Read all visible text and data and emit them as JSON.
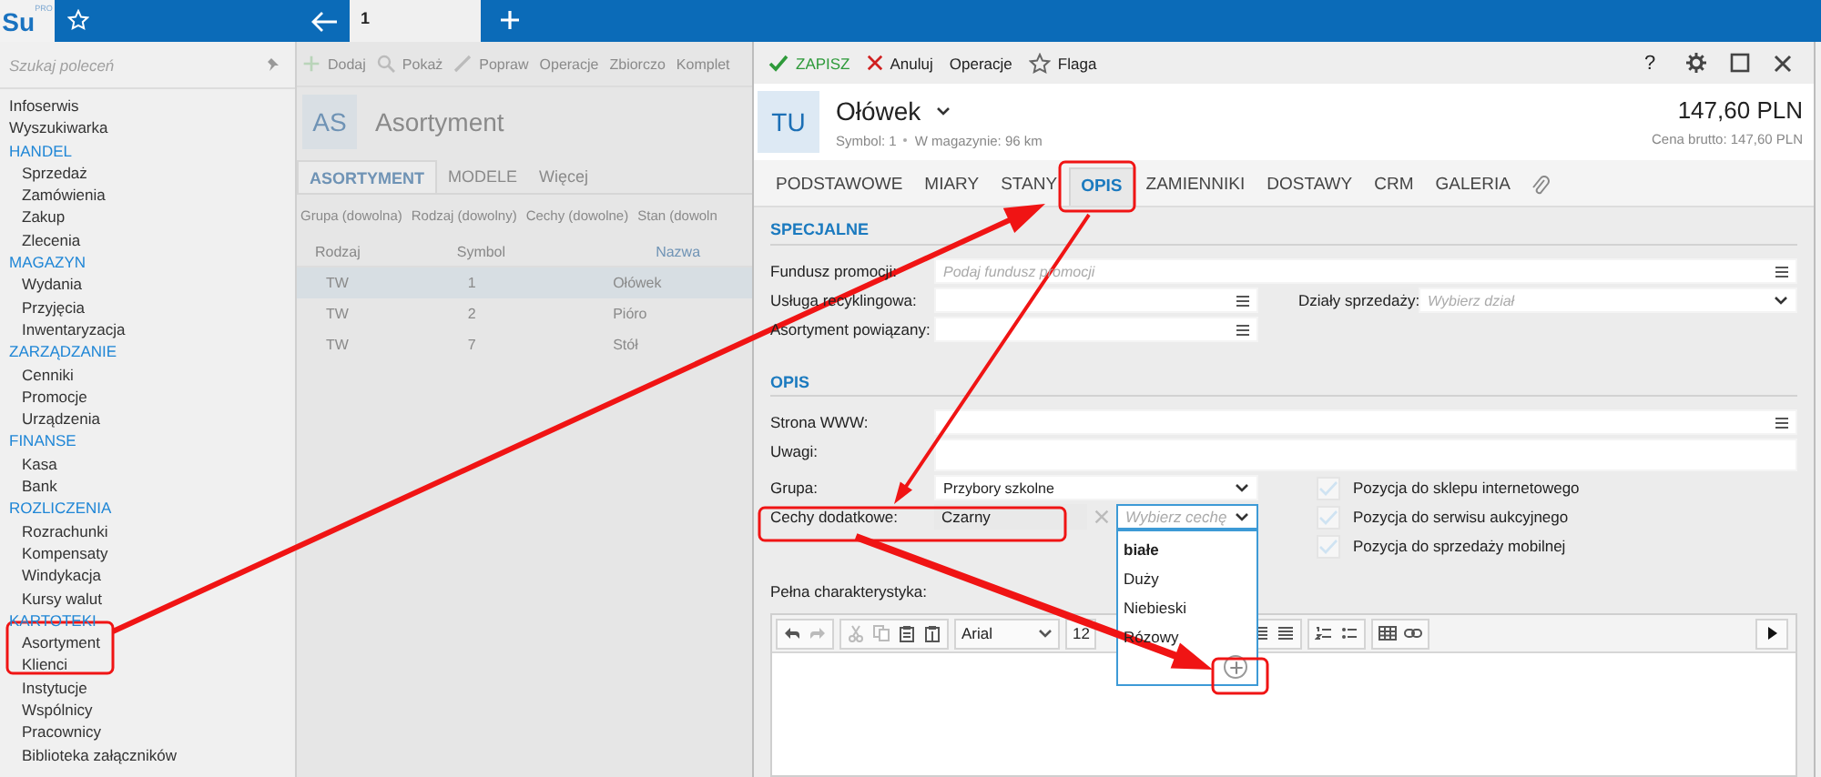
{
  "app_bar": {
    "logo": "Su",
    "logo_badge": "PRO",
    "tabs": [
      {
        "label": "1",
        "selected": true
      }
    ]
  },
  "sidebar": {
    "search_placeholder": "Szukaj poleceń",
    "items": [
      {
        "label": "Infoserwis"
      },
      {
        "label": "Wyszukiwarka"
      },
      {
        "label": "HANDEL",
        "children": [
          {
            "label": "Sprzedaż"
          },
          {
            "label": "Zamówienia"
          },
          {
            "label": "Zakup"
          },
          {
            "label": "Zlecenia"
          }
        ]
      },
      {
        "label": "MAGAZYN",
        "children": [
          {
            "label": "Wydania"
          },
          {
            "label": "Przyjęcia"
          },
          {
            "label": "Inwentaryzacja"
          }
        ]
      },
      {
        "label": "ZARZĄDZANIE",
        "children": [
          {
            "label": "Cenniki"
          },
          {
            "label": "Promocje"
          },
          {
            "label": "Urządzenia"
          }
        ]
      },
      {
        "label": "FINANSE",
        "children": [
          {
            "label": "Kasa"
          },
          {
            "label": "Bank"
          }
        ]
      },
      {
        "label": "ROZLICZENIA",
        "children": [
          {
            "label": "Rozrachunki"
          },
          {
            "label": "Kompensaty"
          },
          {
            "label": "Windykacja"
          },
          {
            "label": "Kursy walut"
          }
        ]
      },
      {
        "label": "KARTOTEKI",
        "children": [
          {
            "label": "Asortyment"
          },
          {
            "label": "Klienci"
          },
          {
            "label": "Instytucje"
          },
          {
            "label": "Wspólnicy"
          },
          {
            "label": "Pracownicy"
          },
          {
            "label": "Biblioteka załączników"
          }
        ]
      }
    ]
  },
  "list_panel": {
    "toolbar": [
      {
        "kind": "add",
        "label": "Dodaj"
      },
      {
        "kind": "show",
        "label": "Pokaż"
      },
      {
        "kind": "edit",
        "label": "Popraw"
      },
      {
        "kind": "plain",
        "label": "Operacje"
      },
      {
        "kind": "plain",
        "label": "Zbiorczo"
      },
      {
        "kind": "plain",
        "label": "Komplet"
      }
    ],
    "avatar": "AS",
    "title": "Asortyment",
    "tabs": [
      {
        "label": "ASORTYMENT",
        "selected": true
      },
      {
        "label": "MODELE",
        "selected": false
      },
      {
        "label": "Więcej",
        "selected": false
      }
    ],
    "filters": [
      "Grupa (dowolna)",
      "Rodzaj (dowolny)",
      "Cechy (dowolne)",
      "Stan (dowoln"
    ],
    "table": {
      "columns": [
        "Rodzaj",
        "Symbol",
        "Nazwa"
      ],
      "rows": [
        {
          "cells": [
            "TW",
            "1",
            "Ołówek"
          ],
          "selected": true
        },
        {
          "cells": [
            "TW",
            "2",
            "Pióro"
          ],
          "selected": false
        },
        {
          "cells": [
            "TW",
            "7",
            "Stół"
          ],
          "selected": false
        }
      ]
    }
  },
  "detail": {
    "toolbar": [
      {
        "kind": "save",
        "label": "ZAPISZ"
      },
      {
        "kind": "cancel",
        "label": "Anuluj"
      },
      {
        "kind": "plain",
        "label": "Operacje"
      },
      {
        "kind": "flag",
        "label": "Flaga"
      }
    ],
    "help": "?",
    "avatar": "TU",
    "title": "Ołówek",
    "symbol": "Symbol: 1",
    "stock": "W magazynie: 96 km",
    "price": "147,60 PLN",
    "gross_price": "Cena brutto: 147,60 PLN",
    "tabs": [
      {
        "label": "PODSTAWOWE",
        "selected": false
      },
      {
        "label": "MIARY",
        "selected": false
      },
      {
        "label": "STANY",
        "selected": false
      },
      {
        "label": "OPIS",
        "selected": true
      },
      {
        "label": "ZAMIENNIKI",
        "selected": false
      },
      {
        "label": "DOSTAWY",
        "selected": false
      },
      {
        "label": "CRM",
        "selected": false
      },
      {
        "label": "GALERIA",
        "selected": false
      }
    ],
    "sections": [
      {
        "title": "SPECJALNE",
        "rows": [
          [
            {
              "kind": "lookup",
              "label": "Fundusz promocji:",
              "placeholder": "Podaj fundusz promocji"
            }
          ],
          [
            {
              "kind": "lookup",
              "label": "Usługa recyklingowa:"
            },
            {
              "kind": "select",
              "label": "Działy sprzedaży:",
              "placeholder": "Wybierz dział"
            }
          ],
          [
            {
              "kind": "lookup",
              "label": "Asortyment powiązany:"
            }
          ]
        ]
      },
      {
        "title": "OPIS",
        "rows": [
          [
            {
              "kind": "lookup",
              "label": "Strona WWW:"
            }
          ],
          [
            {
              "kind": "textarea",
              "label": "Uwagi:"
            }
          ],
          [
            {
              "kind": "select",
              "label": "Grupa:",
              "value": "Przybory szkolne"
            }
          ],
          [
            {
              "kind": "tags",
              "label": "Cechy dodatkowe:",
              "value": "Czarny",
              "placeholder": "Wybierz cechę",
              "expanded": true
            }
          ]
        ],
        "checkboxes": [
          {
            "label": "Pozycja do sklepu internetowego",
            "checked": false
          },
          {
            "label": "Pozycja do serwisu aukcyjnego",
            "checked": false
          },
          {
            "label": "Pozycja do sprzedaży mobilnej",
            "checked": false
          }
        ]
      }
    ],
    "feature_menu": {
      "options": [
        {
          "label": "białe",
          "selected": true
        },
        {
          "label": "Duży",
          "selected": false
        },
        {
          "label": "Niebieski",
          "selected": false
        },
        {
          "label": "Rózowy",
          "selected": false
        }
      ]
    },
    "editor": {
      "label": "Pełna charakterystyka:",
      "font": "Arial",
      "size": "12"
    }
  }
}
